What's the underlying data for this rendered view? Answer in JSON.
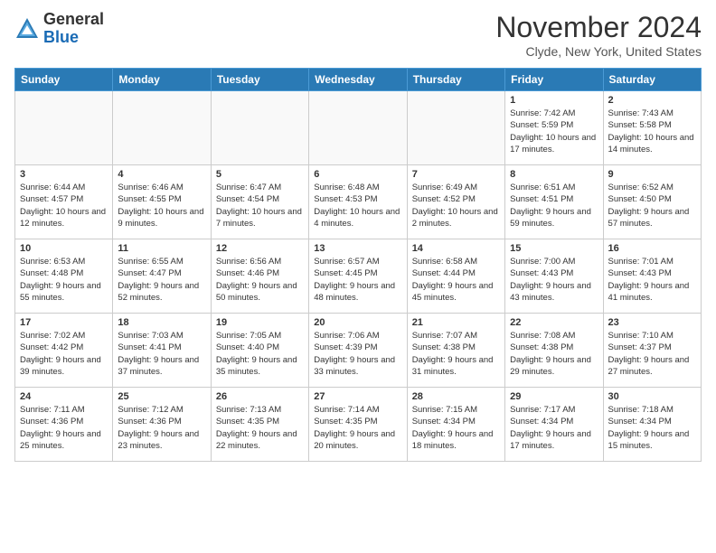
{
  "logo": {
    "general": "General",
    "blue": "Blue"
  },
  "title": "November 2024",
  "location": "Clyde, New York, United States",
  "days_of_week": [
    "Sunday",
    "Monday",
    "Tuesday",
    "Wednesday",
    "Thursday",
    "Friday",
    "Saturday"
  ],
  "weeks": [
    [
      {
        "day": "",
        "info": ""
      },
      {
        "day": "",
        "info": ""
      },
      {
        "day": "",
        "info": ""
      },
      {
        "day": "",
        "info": ""
      },
      {
        "day": "",
        "info": ""
      },
      {
        "day": "1",
        "info": "Sunrise: 7:42 AM\nSunset: 5:59 PM\nDaylight: 10 hours and 17 minutes."
      },
      {
        "day": "2",
        "info": "Sunrise: 7:43 AM\nSunset: 5:58 PM\nDaylight: 10 hours and 14 minutes."
      }
    ],
    [
      {
        "day": "3",
        "info": "Sunrise: 6:44 AM\nSunset: 4:57 PM\nDaylight: 10 hours and 12 minutes."
      },
      {
        "day": "4",
        "info": "Sunrise: 6:46 AM\nSunset: 4:55 PM\nDaylight: 10 hours and 9 minutes."
      },
      {
        "day": "5",
        "info": "Sunrise: 6:47 AM\nSunset: 4:54 PM\nDaylight: 10 hours and 7 minutes."
      },
      {
        "day": "6",
        "info": "Sunrise: 6:48 AM\nSunset: 4:53 PM\nDaylight: 10 hours and 4 minutes."
      },
      {
        "day": "7",
        "info": "Sunrise: 6:49 AM\nSunset: 4:52 PM\nDaylight: 10 hours and 2 minutes."
      },
      {
        "day": "8",
        "info": "Sunrise: 6:51 AM\nSunset: 4:51 PM\nDaylight: 9 hours and 59 minutes."
      },
      {
        "day": "9",
        "info": "Sunrise: 6:52 AM\nSunset: 4:50 PM\nDaylight: 9 hours and 57 minutes."
      }
    ],
    [
      {
        "day": "10",
        "info": "Sunrise: 6:53 AM\nSunset: 4:48 PM\nDaylight: 9 hours and 55 minutes."
      },
      {
        "day": "11",
        "info": "Sunrise: 6:55 AM\nSunset: 4:47 PM\nDaylight: 9 hours and 52 minutes."
      },
      {
        "day": "12",
        "info": "Sunrise: 6:56 AM\nSunset: 4:46 PM\nDaylight: 9 hours and 50 minutes."
      },
      {
        "day": "13",
        "info": "Sunrise: 6:57 AM\nSunset: 4:45 PM\nDaylight: 9 hours and 48 minutes."
      },
      {
        "day": "14",
        "info": "Sunrise: 6:58 AM\nSunset: 4:44 PM\nDaylight: 9 hours and 45 minutes."
      },
      {
        "day": "15",
        "info": "Sunrise: 7:00 AM\nSunset: 4:43 PM\nDaylight: 9 hours and 43 minutes."
      },
      {
        "day": "16",
        "info": "Sunrise: 7:01 AM\nSunset: 4:43 PM\nDaylight: 9 hours and 41 minutes."
      }
    ],
    [
      {
        "day": "17",
        "info": "Sunrise: 7:02 AM\nSunset: 4:42 PM\nDaylight: 9 hours and 39 minutes."
      },
      {
        "day": "18",
        "info": "Sunrise: 7:03 AM\nSunset: 4:41 PM\nDaylight: 9 hours and 37 minutes."
      },
      {
        "day": "19",
        "info": "Sunrise: 7:05 AM\nSunset: 4:40 PM\nDaylight: 9 hours and 35 minutes."
      },
      {
        "day": "20",
        "info": "Sunrise: 7:06 AM\nSunset: 4:39 PM\nDaylight: 9 hours and 33 minutes."
      },
      {
        "day": "21",
        "info": "Sunrise: 7:07 AM\nSunset: 4:38 PM\nDaylight: 9 hours and 31 minutes."
      },
      {
        "day": "22",
        "info": "Sunrise: 7:08 AM\nSunset: 4:38 PM\nDaylight: 9 hours and 29 minutes."
      },
      {
        "day": "23",
        "info": "Sunrise: 7:10 AM\nSunset: 4:37 PM\nDaylight: 9 hours and 27 minutes."
      }
    ],
    [
      {
        "day": "24",
        "info": "Sunrise: 7:11 AM\nSunset: 4:36 PM\nDaylight: 9 hours and 25 minutes."
      },
      {
        "day": "25",
        "info": "Sunrise: 7:12 AM\nSunset: 4:36 PM\nDaylight: 9 hours and 23 minutes."
      },
      {
        "day": "26",
        "info": "Sunrise: 7:13 AM\nSunset: 4:35 PM\nDaylight: 9 hours and 22 minutes."
      },
      {
        "day": "27",
        "info": "Sunrise: 7:14 AM\nSunset: 4:35 PM\nDaylight: 9 hours and 20 minutes."
      },
      {
        "day": "28",
        "info": "Sunrise: 7:15 AM\nSunset: 4:34 PM\nDaylight: 9 hours and 18 minutes."
      },
      {
        "day": "29",
        "info": "Sunrise: 7:17 AM\nSunset: 4:34 PM\nDaylight: 9 hours and 17 minutes."
      },
      {
        "day": "30",
        "info": "Sunrise: 7:18 AM\nSunset: 4:34 PM\nDaylight: 9 hours and 15 minutes."
      }
    ]
  ]
}
